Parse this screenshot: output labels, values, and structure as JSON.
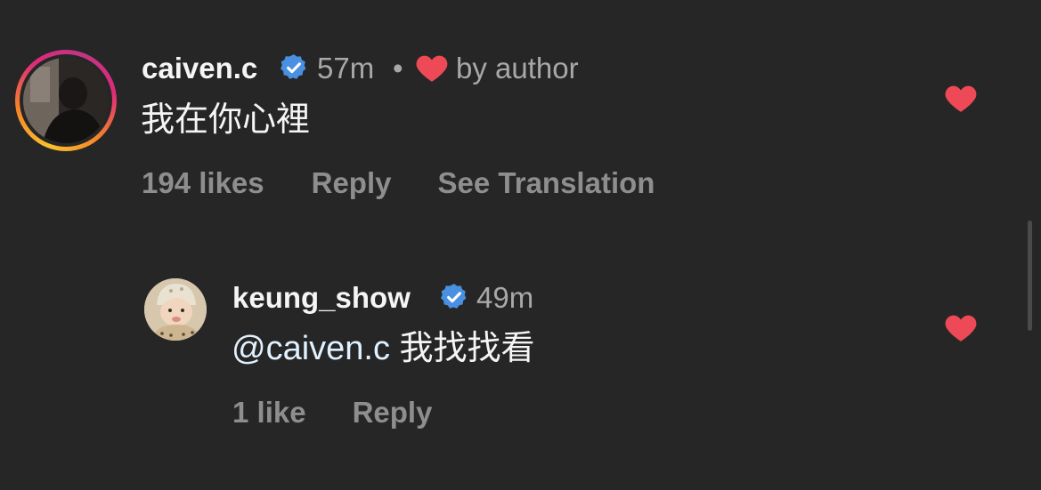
{
  "comments": [
    {
      "username": "caiven.c",
      "verified": true,
      "time": "57m",
      "separator": "•",
      "author_like_label": "by author",
      "text": "我在你心裡",
      "likes_label": "194 likes",
      "reply_label": "Reply",
      "translate_label": "See Translation",
      "liked": true
    },
    {
      "username": "keung_show",
      "verified": true,
      "time": "49m",
      "mention": "@caiven.c",
      "text": "我找找看",
      "likes_label": "1 like",
      "reply_label": "Reply",
      "liked": true
    }
  ],
  "icons": {
    "verified": "verified-badge-icon",
    "heart": "heart-icon"
  },
  "colors": {
    "background": "#262626",
    "heart": "#ed4956",
    "verified": "#4a90e2",
    "secondary_text": "#a8a8a8",
    "action_text": "#8e8e8e",
    "mention": "#e0f1ff"
  }
}
